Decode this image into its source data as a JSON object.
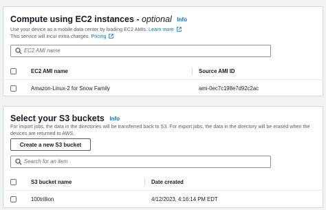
{
  "ec2": {
    "title": "Compute using EC2 instances - ",
    "title_optional": "optional",
    "info": "Info",
    "desc_line1": "Use your device as a mobile data center by loading EC2 AMIs.",
    "learn_more": "Learn more",
    "desc_line2": "This service will incur extra charges.",
    "pricing": "Pricing",
    "search_placeholder": "EC2 AMI name",
    "columns": [
      "EC2 AMI name",
      "Source AMI ID"
    ],
    "rows": [
      {
        "name": "Amazon-Linux-2 for Snow Family",
        "id": "ami-0ec7c198e7d92c2ac"
      }
    ]
  },
  "s3": {
    "title": "Select your S3 buckets",
    "info": "Info",
    "desc": "For import jobs, the data in the directories will be transferred back to S3. For export jobs, the data in the directory will be erased when the devices are returned to AWS.",
    "create_button": "Create a new S3 bucket",
    "search_placeholder": "Search for an item",
    "columns": [
      "S3 bucket name",
      "Date created"
    ],
    "rows": [
      {
        "name": "100trillion",
        "date": "4/12/2023, 4:16:14 PM EDT"
      }
    ]
  },
  "colors": {
    "link": "#0073bb",
    "border": "#d5dbdb",
    "background": "#f2f3f3"
  }
}
